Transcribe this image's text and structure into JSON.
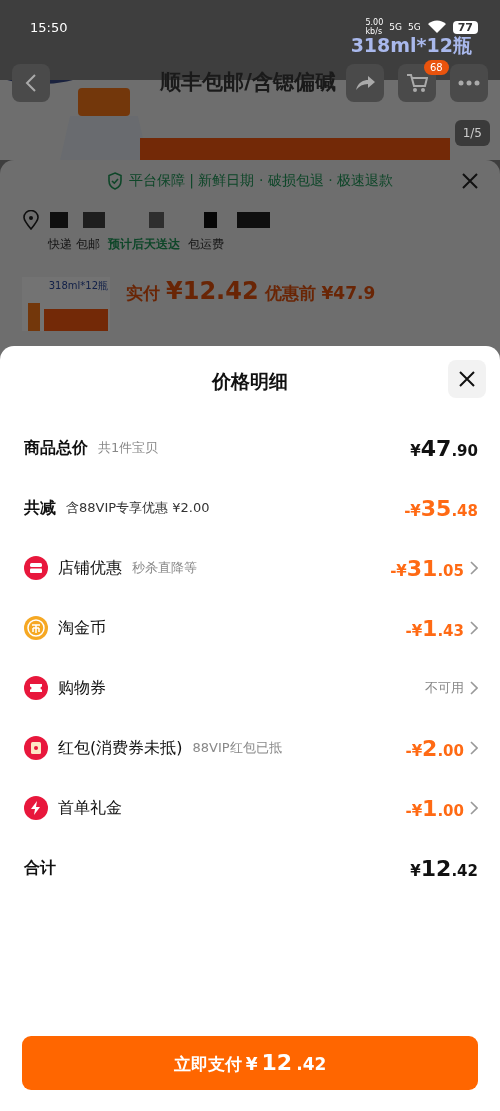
{
  "status_bar": {
    "time": "15:50",
    "net_speed": "5.00",
    "net_unit": "kb/s",
    "sim_1": "5G",
    "sim_2": "5G",
    "battery": "77"
  },
  "product_page": {
    "title_line_1": "318ml*12瓶",
    "title_line_2": "顺丰包邮/含锶偏碱",
    "cart_badge": "68",
    "image_counter": "1/5"
  },
  "order_sheet": {
    "guarantee": "平台保障 | 新鲜日期 · 破损包退 · 极速退款",
    "shipping": "快递 包邮",
    "delivery": "预计后天送达",
    "freight": "包运费",
    "paid_label": "实付",
    "paid_price": "¥12.42",
    "before_label": "优惠前 ¥47.9",
    "product_label": "318ml*12瓶"
  },
  "price_sheet": {
    "title": "价格明细",
    "rows": [
      {
        "kind": "total",
        "label": "商品总价",
        "note": "共1件宝贝",
        "value": "¥47.90"
      },
      {
        "kind": "saving",
        "label": "共减",
        "note": "含88VIP专享优惠 ¥2.00",
        "value": "-¥35.48"
      },
      {
        "kind": "discount",
        "label": "店铺优惠",
        "note": "秒杀直降等",
        "value": "-¥31.05"
      },
      {
        "kind": "discount",
        "label": "淘金币",
        "value": "-¥1.43"
      },
      {
        "kind": "unavailable",
        "label": "购物券",
        "value": "不可用"
      },
      {
        "kind": "discount",
        "label": "红包(消费券未抵)",
        "note": "88VIP红包已抵",
        "value": "-¥2.00"
      },
      {
        "kind": "discount",
        "label": "首单礼金",
        "value": "-¥1.00"
      },
      {
        "kind": "total",
        "label": "合计",
        "value": "¥12.42"
      }
    ],
    "pay_label": "立即支付",
    "pay_price": "¥12.42"
  }
}
